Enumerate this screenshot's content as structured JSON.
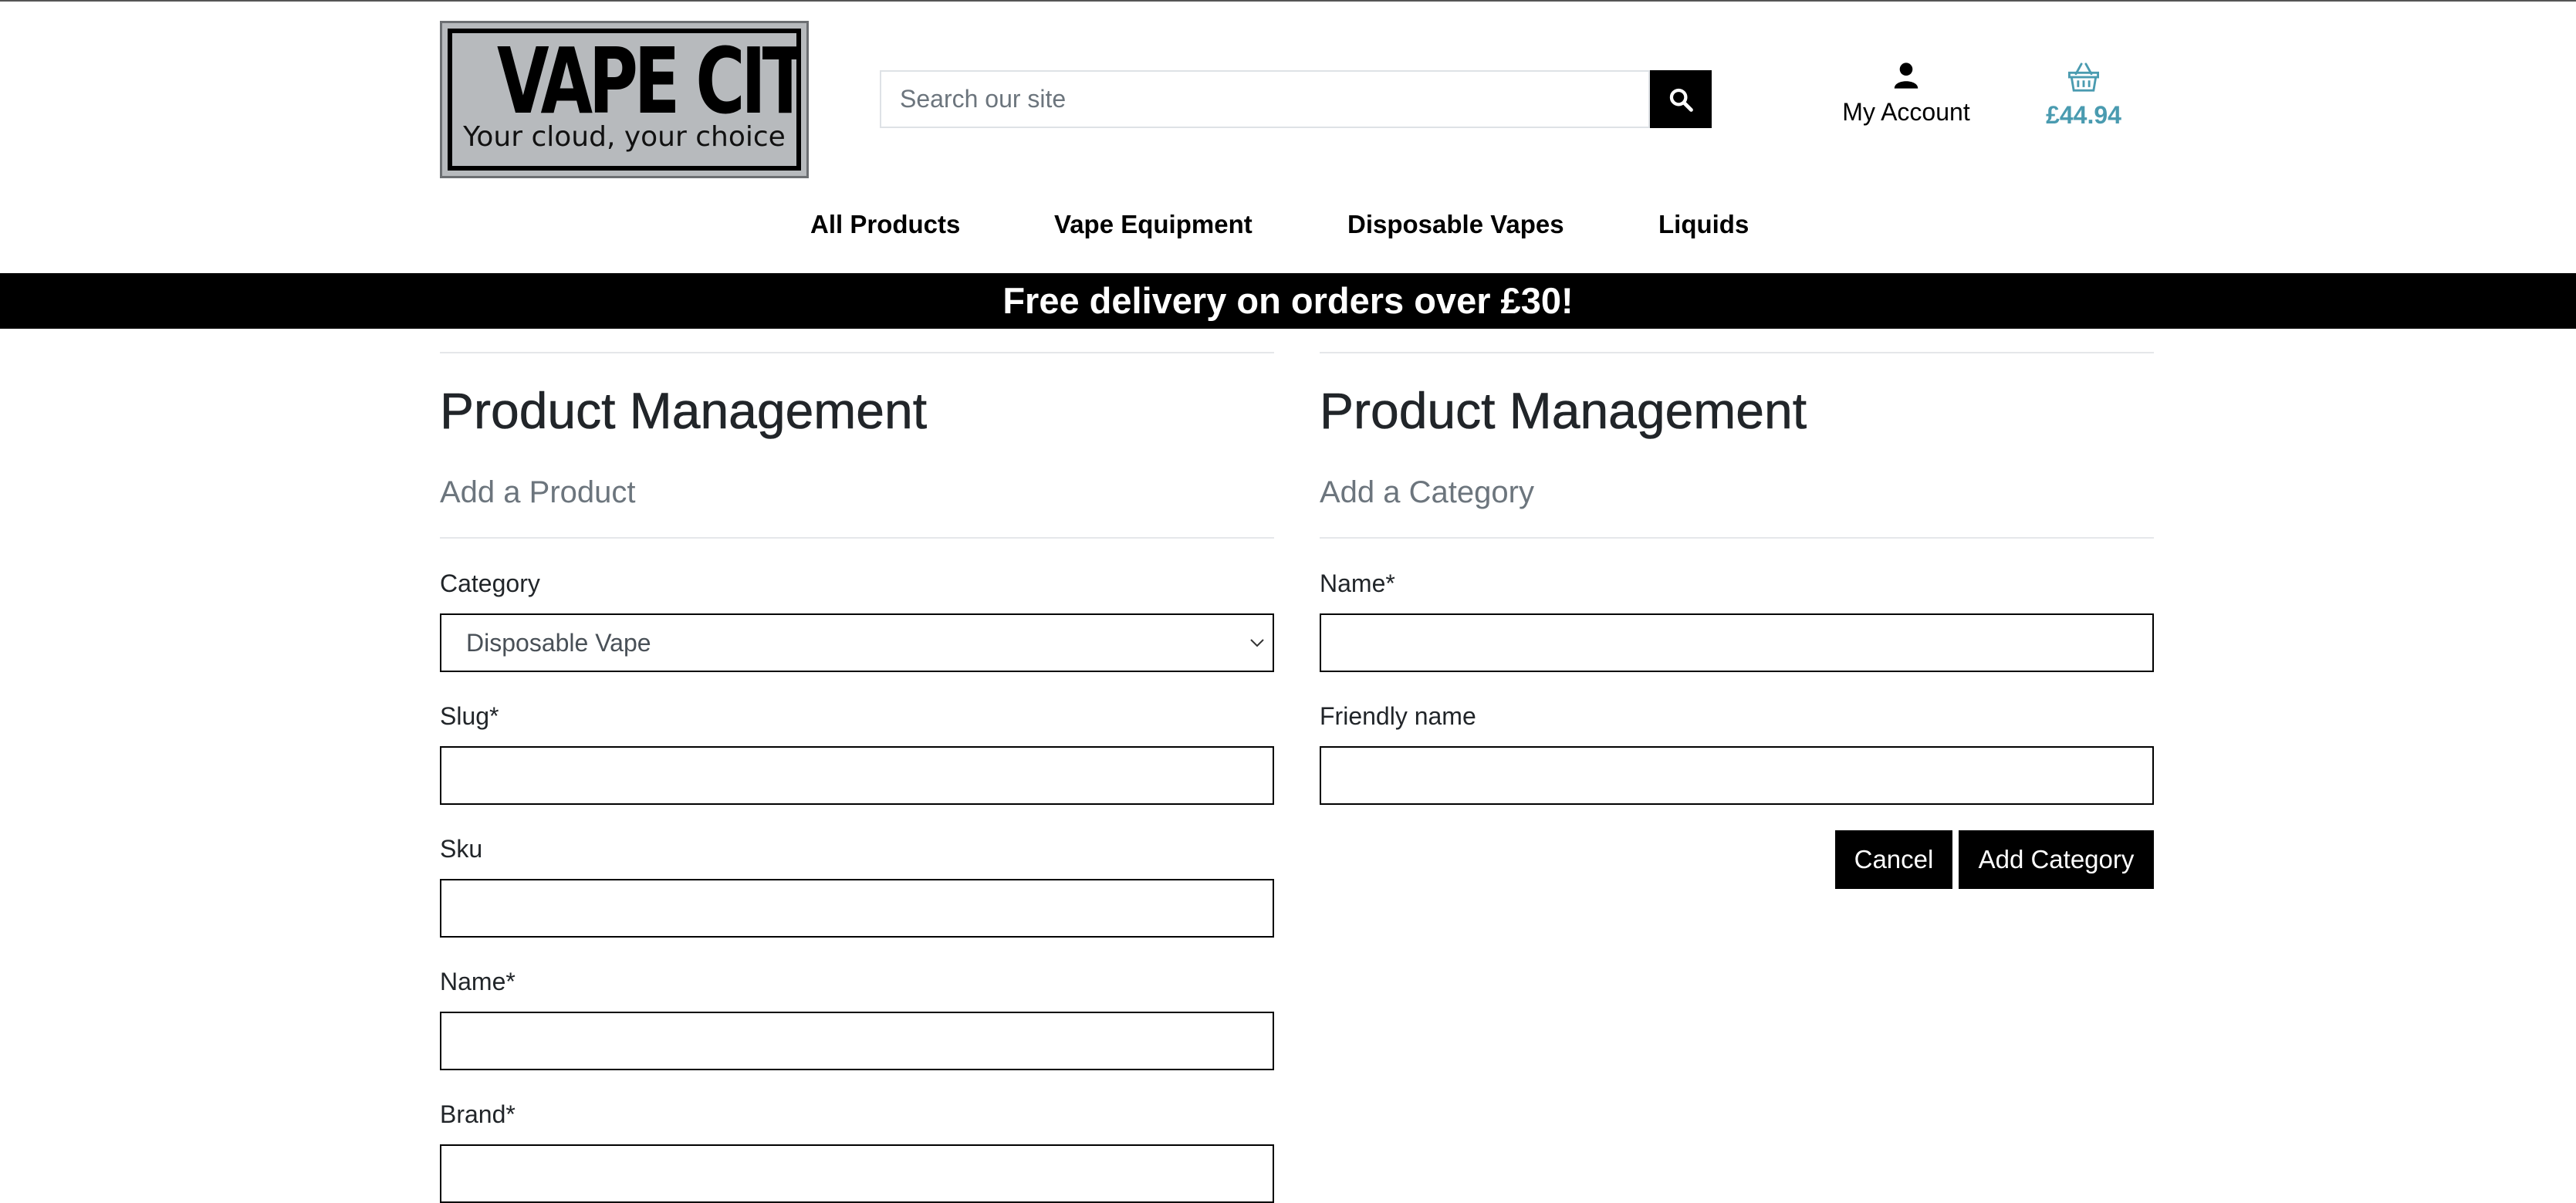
{
  "header": {
    "logo": {
      "title": "VAPE CITY",
      "tagline": "Your cloud, your choice"
    },
    "search": {
      "placeholder": "Search our site",
      "value": ""
    },
    "search_icon": "magnifier-icon",
    "account": {
      "label": "My Account",
      "icon": "user-icon"
    },
    "basket": {
      "total": "£44.94",
      "icon": "basket-icon"
    },
    "nav": [
      "All Products",
      "Vape Equipment",
      "Disposable Vapes",
      "Liquids"
    ]
  },
  "banner": {
    "text": "Free delivery on orders over £30!"
  },
  "product_form": {
    "title": "Product Management",
    "subtitle": "Add a Product",
    "category_label": "Category",
    "category_value": "Disposable Vape",
    "slug_label": "Slug*",
    "sku_label": "Sku",
    "name_label": "Name*",
    "brand_label": "Brand*"
  },
  "category_form": {
    "title": "Product Management",
    "subtitle": "Add a Category",
    "name_label": "Name*",
    "friendly_name_label": "Friendly name",
    "cancel_label": "Cancel",
    "submit_label": "Add Category"
  },
  "colors": {
    "accent": "#4a9bb0",
    "banner_bg": "#000000",
    "muted_text": "#6c757d"
  }
}
